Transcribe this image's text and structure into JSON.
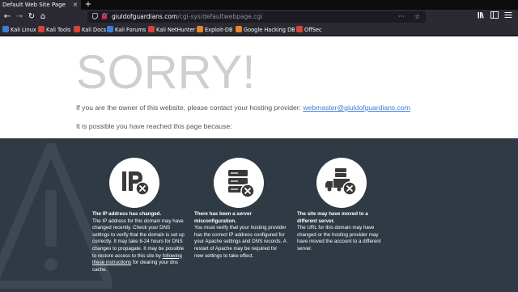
{
  "tab": {
    "title": "Default Web Site Page",
    "close": "×",
    "new": "+"
  },
  "nav": {
    "back": "←",
    "forward": "→",
    "reload": "↻",
    "home": "⌂"
  },
  "url": {
    "domain": "giuldofguardians.com",
    "path": "/cgi-sys/defaultwebpage.cgi",
    "menu": "···",
    "star": "☆"
  },
  "bookmarks": [
    {
      "label": "Kali Linux",
      "color": "#3d7fd6"
    },
    {
      "label": "Kali Tools",
      "color": "#d9413c"
    },
    {
      "label": "Kali Docs",
      "color": "#d9413c"
    },
    {
      "label": "Kali Forums",
      "color": "#3d7fd6"
    },
    {
      "label": "Kali NetHunter",
      "color": "#d9413c"
    },
    {
      "label": "Exploit-DB",
      "color": "#e8852b"
    },
    {
      "label": "Google Hacking DB",
      "color": "#e8852b"
    },
    {
      "label": "OffSec",
      "color": "#d9413c"
    }
  ],
  "page": {
    "heading": "SORRY!",
    "owner_text": "If you are the owner of this website, please contact your hosting provider: ",
    "owner_email": "webmaster@giuldofguardians.com",
    "reached_text": "It is possible you have reached this page because:"
  },
  "reasons": [
    {
      "icon": "ip-x-icon",
      "title": "The IP address has changed.",
      "body": "The IP address for this domain may have changed recently. Check your DNS settings to verify that the domain is set up correctly. It may take 8-24 hours for DNS changes to propagate. It may be possible to restore access to this site by",
      "link": "following these instructions",
      "tail": "for clearing your dns cache."
    },
    {
      "icon": "server-x-icon",
      "title": "There has been a server misconfiguration.",
      "body": "You must verify that your hosting provider has the correct IP address configured for your Apache settings and DNS records. A restart of Apache may be required for new settings to take effect."
    },
    {
      "icon": "truck-x-icon",
      "title": "The site may have moved to a different server.",
      "body": "The URL for this domain may have changed or the hosting provider may have moved the account to a different server."
    }
  ]
}
